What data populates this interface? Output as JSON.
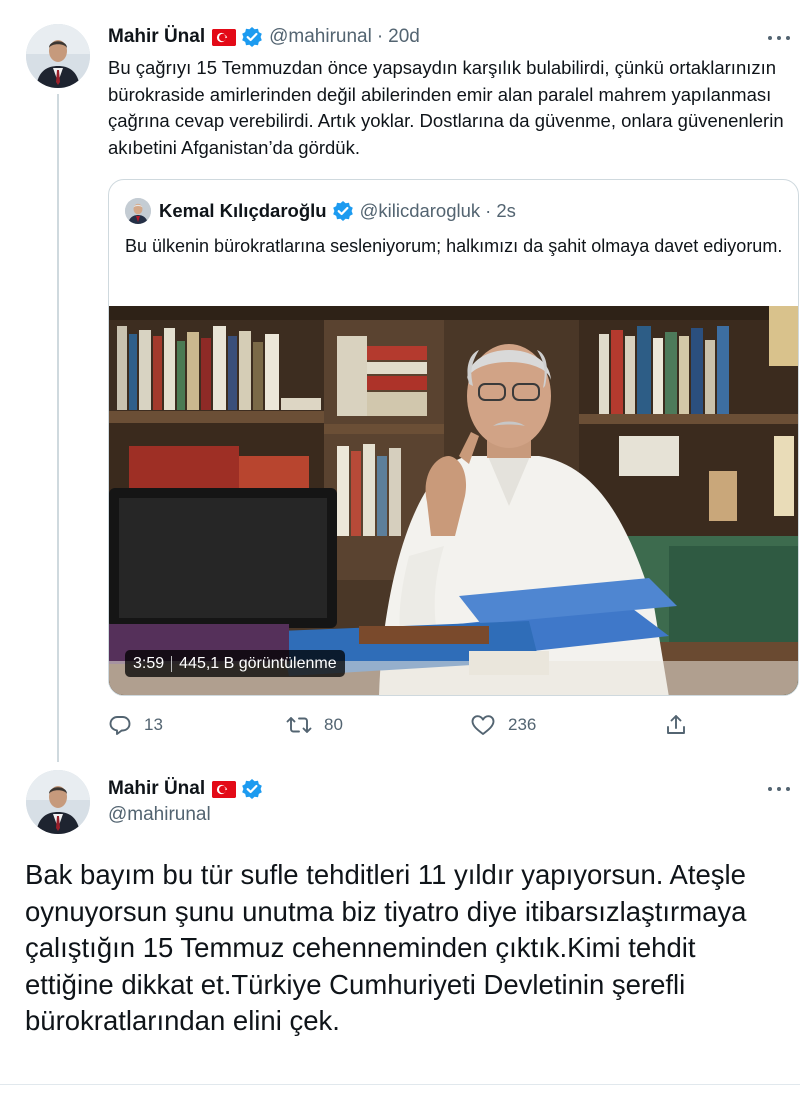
{
  "tweet1": {
    "author_name": "Mahir Ünal",
    "handle": "@mahirunal",
    "separator": "·",
    "time": "20d",
    "text": "Bu çağrıyı 15 Temmuzdan önce yapsaydın karşılık bulabilirdi, çünkü ortaklarınızın bürokraside amirlerinden değil abilerinden emir alan paralel mahrem yapılanması çağrına cevap verebilirdi. Artık yoklar. Dostlarına da güvenme, onlara güvenenlerin akıbetini Afganistan’da gördük.",
    "quote": {
      "author_name": "Kemal Kılıçdaroğlu",
      "handle": "@kilicdarogluk",
      "separator": "·",
      "time": "2s",
      "text": "Bu ülkenin bürokratlarına sesleniyorum; halkımızı da şahit olmaya davet ediyorum.",
      "video": {
        "duration": "3:59",
        "views": "445,1 B görüntülenme"
      }
    },
    "actions": {
      "replies": "13",
      "retweets": "80",
      "likes": "236"
    }
  },
  "tweet2": {
    "author_name": "Mahir Ünal",
    "handle": "@mahirunal",
    "text": "Bak bayım bu tür sufle tehditleri 11 yıldır yapıyorsun. Ateşle oynuyorsun şunu unutma biz tiyatro diye itibarsızlaştırmaya çalıştığın 15 Temmuz cehenneminden çıktık.Kimi tehdit ettiğine dikkat et.Türkiye Cumhuriyeti Devletinin şerefli bürokratlarından elini çek."
  },
  "icons": {
    "more": "more-icon",
    "flag": "turkey-flag-icon",
    "verified": "verified-badge-icon",
    "reply": "reply-icon",
    "retweet": "retweet-icon",
    "like": "like-icon",
    "share": "share-icon"
  },
  "colors": {
    "text": "#0f1419",
    "secondary": "#536471",
    "verified": "#1d9bf0",
    "border": "#cfd9de",
    "flag_red": "#e30a17"
  }
}
